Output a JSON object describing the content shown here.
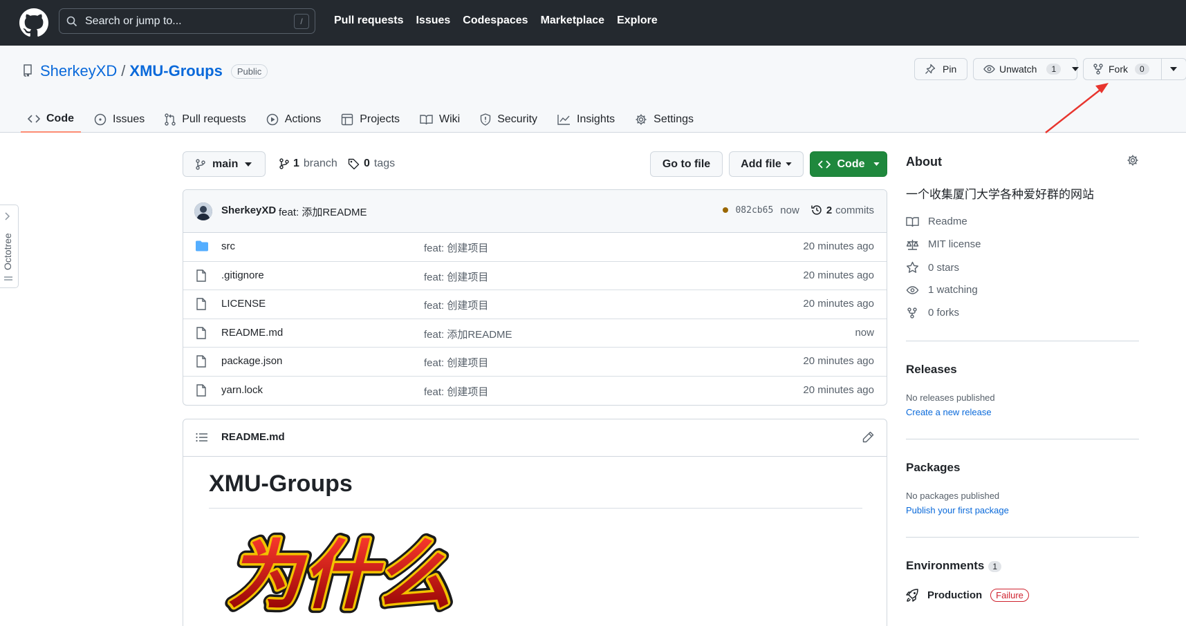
{
  "topnav": {
    "search_placeholder": "Search or jump to...",
    "search_shortcut": "/",
    "links": [
      "Pull requests",
      "Issues",
      "Codespaces",
      "Marketplace",
      "Explore"
    ]
  },
  "repo": {
    "owner": "SherkeyXD",
    "separator": "/",
    "name": "XMU-Groups",
    "visibility": "Public",
    "pin_label": "Pin",
    "watch_label": "Unwatch",
    "watch_count": "1",
    "fork_label": "Fork",
    "fork_count": "0",
    "tabs": [
      {
        "label": "Code",
        "icon": "code-icon",
        "active": true
      },
      {
        "label": "Issues",
        "icon": "issue-icon"
      },
      {
        "label": "Pull requests",
        "icon": "pull-request-icon"
      },
      {
        "label": "Actions",
        "icon": "play-icon"
      },
      {
        "label": "Projects",
        "icon": "table-icon"
      },
      {
        "label": "Wiki",
        "icon": "book-icon"
      },
      {
        "label": "Security",
        "icon": "shield-icon"
      },
      {
        "label": "Insights",
        "icon": "graph-icon"
      },
      {
        "label": "Settings",
        "icon": "gear-icon"
      }
    ]
  },
  "octotree": {
    "label": "Octotree"
  },
  "branchbar": {
    "branch": "main",
    "branch_count": "1",
    "branch_word": "branch",
    "tag_count": "0",
    "tag_word": "tags",
    "goto_label": "Go to file",
    "addfile_label": "Add file",
    "code_label": "Code"
  },
  "latest_commit": {
    "author": "SherkeyXD",
    "message": "feat: 添加README",
    "sha": "082cb65",
    "time": "now",
    "commits_count": "2",
    "commits_word": "commits",
    "status_color": "#9a6700"
  },
  "files": [
    {
      "name": "src",
      "type": "folder",
      "message": "feat: 创建项目",
      "time": "20 minutes ago"
    },
    {
      "name": ".gitignore",
      "type": "file",
      "message": "feat: 创建项目",
      "time": "20 minutes ago"
    },
    {
      "name": "LICENSE",
      "type": "file",
      "message": "feat: 创建项目",
      "time": "20 minutes ago"
    },
    {
      "name": "README.md",
      "type": "file",
      "message": "feat: 添加README",
      "time": "now"
    },
    {
      "name": "package.json",
      "type": "file",
      "message": "feat: 创建项目",
      "time": "20 minutes ago"
    },
    {
      "name": "yarn.lock",
      "type": "file",
      "message": "feat: 创建项目",
      "time": "20 minutes ago"
    }
  ],
  "readme": {
    "filename": "README.md",
    "heading": "XMU-Groups",
    "image_text": "为什么"
  },
  "about": {
    "title": "About",
    "description": "一个收集厦门大学各种爱好群的网站",
    "readme": "Readme",
    "license": "MIT license",
    "stars": "0 stars",
    "watching": "1 watching",
    "forks": "0 forks"
  },
  "releases": {
    "title": "Releases",
    "empty": "No releases published",
    "link": "Create a new release"
  },
  "packages": {
    "title": "Packages",
    "empty": "No packages published",
    "link": "Publish your first package"
  },
  "environments": {
    "title": "Environments",
    "count": "1",
    "name": "Production",
    "status": "Failure"
  },
  "colors": {
    "topbar": "#24292f",
    "link": "#0969da",
    "code_button": "#1f883d",
    "active_tab_underline": "#fd8c73",
    "annotation_arrow": "#e8352e"
  }
}
